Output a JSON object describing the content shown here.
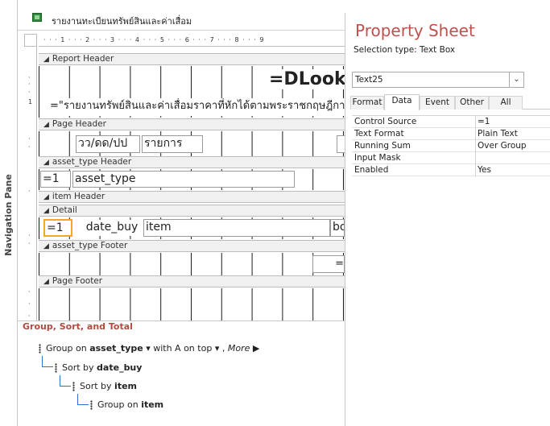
{
  "navigation_pane": {
    "label": "Navigation Pane"
  },
  "document_tab": {
    "title": "รายงานทะเบียนทรัพย์สินและค่าเสื่อม"
  },
  "ruler": {
    "marks": "· · · 1 · · · 2 · · · 3 · · · 4 · · · 5 · · · 6 · · · 7 · · · 8 · · · 9"
  },
  "report": {
    "bands": {
      "report_header": "Report Header",
      "page_header": "Page Header",
      "asset_type_header": "asset_type Header",
      "item_header": "item Header",
      "detail": "Detail",
      "asset_type_footer": "asset_type Footer",
      "page_footer": "Page Footer"
    },
    "controls": {
      "dlookup": "=DLook",
      "subtitle": "=\"รายงานทรัพย์สินและค่าเสื่อมราคาที่หักได้ตามพระราชกฤษฎีกา ฉ",
      "col_date": "วว/ดด/ปป",
      "col_item": "รายการ",
      "group_counter": "=1",
      "group_field": "asset_type",
      "detail_counter": "=1",
      "detail_date": "date_buy",
      "detail_item": "item",
      "detail_more": "bo",
      "footer_eq": "="
    }
  },
  "property_sheet": {
    "title": "Property Sheet",
    "selection_type": "Selection type:  Text Box",
    "selected_control": "Text25",
    "tabs": [
      "Format",
      "Data",
      "Event",
      "Other",
      "All"
    ],
    "active_tab": "Data",
    "properties": [
      {
        "name": "Control Source",
        "value": "=1"
      },
      {
        "name": "Text Format",
        "value": "Plain Text"
      },
      {
        "name": "Running Sum",
        "value": "Over Group"
      },
      {
        "name": "Input Mask",
        "value": ""
      },
      {
        "name": "Enabled",
        "value": "Yes"
      }
    ]
  },
  "group_sort_total": {
    "title": "Group, Sort, and Total",
    "rows": [
      {
        "prefix": "Group on",
        "field": "asset_type",
        "order": "with A on top",
        "more": "More ▶"
      },
      {
        "prefix": "Sort by",
        "field": "date_buy"
      },
      {
        "prefix": "Sort by",
        "field": "item"
      },
      {
        "prefix": "Group on",
        "field": "item"
      }
    ]
  }
}
